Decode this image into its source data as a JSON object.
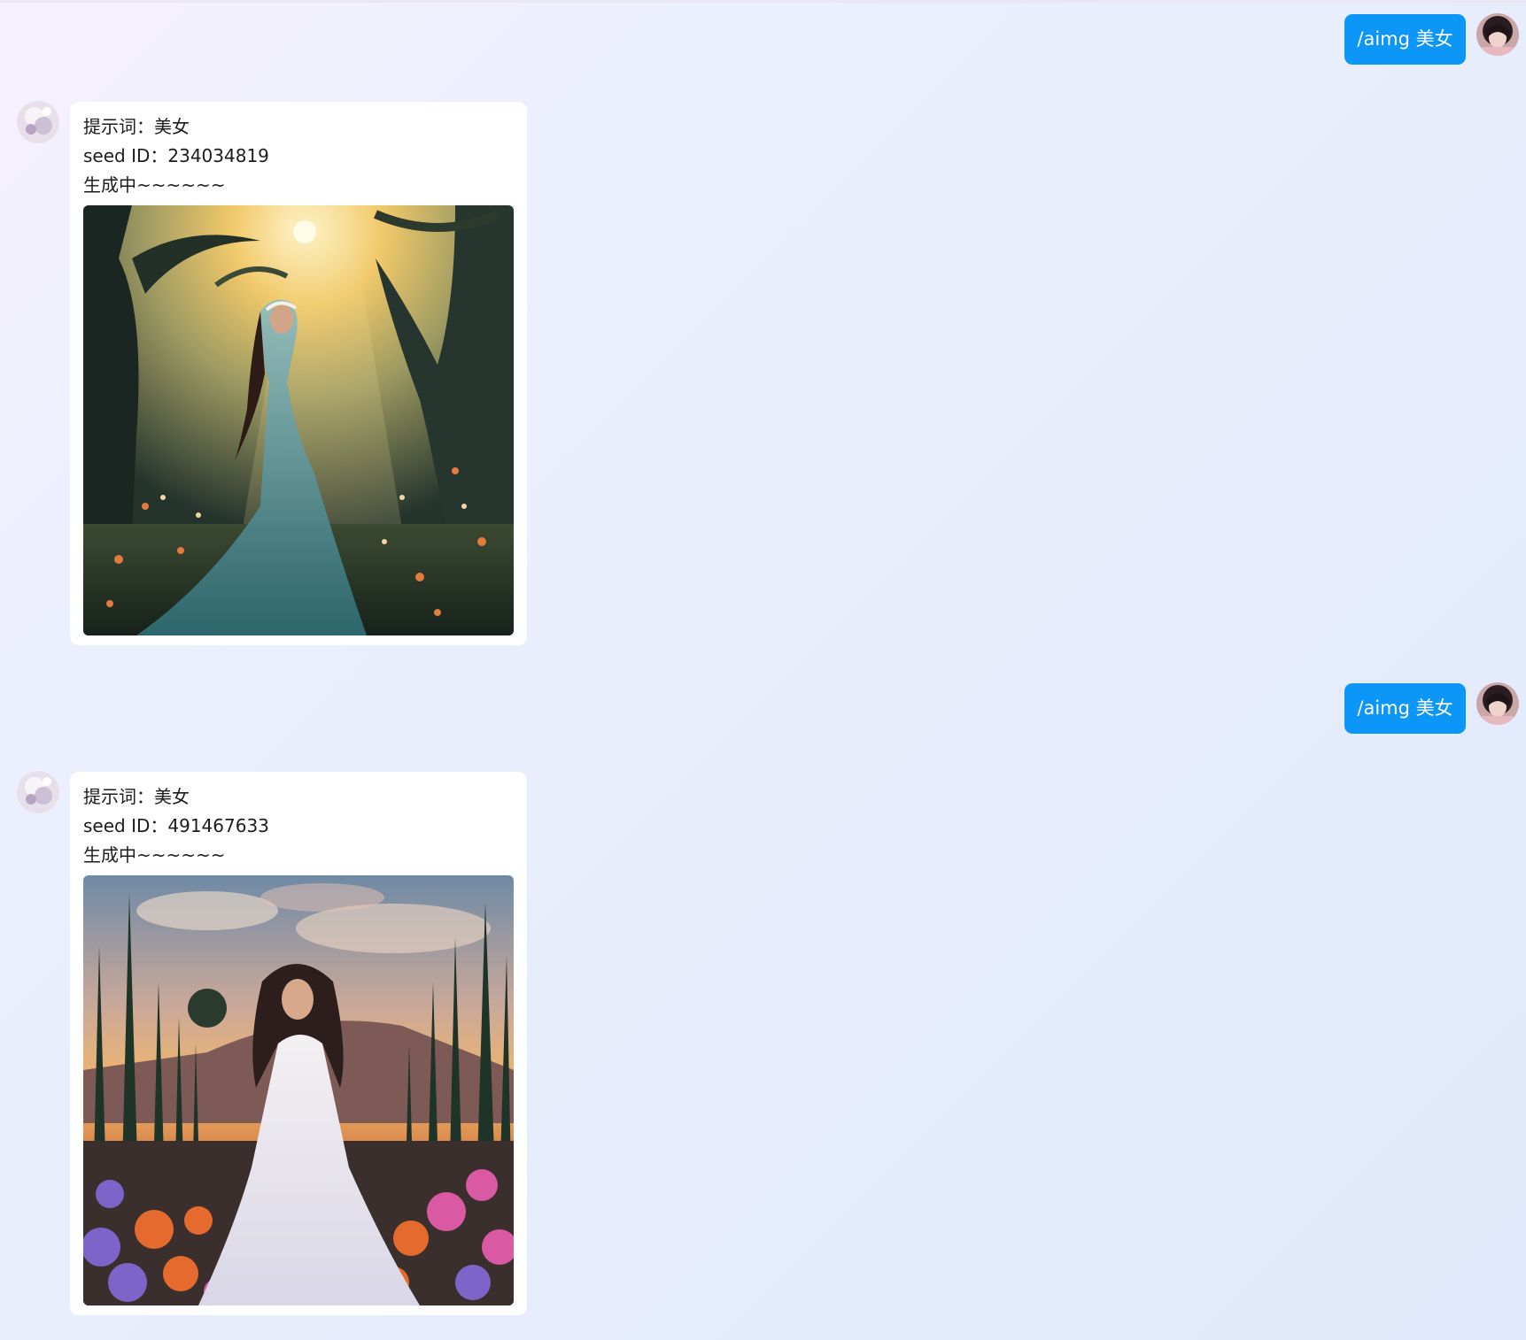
{
  "conversation": {
    "messages": [
      {
        "role": "user",
        "text": "/aimg 美女",
        "avatar": "user-avatar-icon"
      },
      {
        "role": "bot",
        "avatar": "bot-avatar-icon",
        "prompt_line": "提示词：美女",
        "seed_line": "seed ID：234034819",
        "status_line": "生成中~~~~~~",
        "image": "forest-woman-image"
      },
      {
        "role": "user",
        "text": "/aimg 美女",
        "avatar": "user-avatar-icon"
      },
      {
        "role": "bot",
        "avatar": "bot-avatar-icon",
        "prompt_line": "提示词：美女",
        "seed_line": "seed ID：491467633",
        "status_line": "生成中~~~~~~",
        "image": "garden-woman-image"
      }
    ]
  },
  "colors": {
    "user_bubble": "#0b96f8",
    "card_background": "#ffffff",
    "page_background": "#eceffd"
  }
}
